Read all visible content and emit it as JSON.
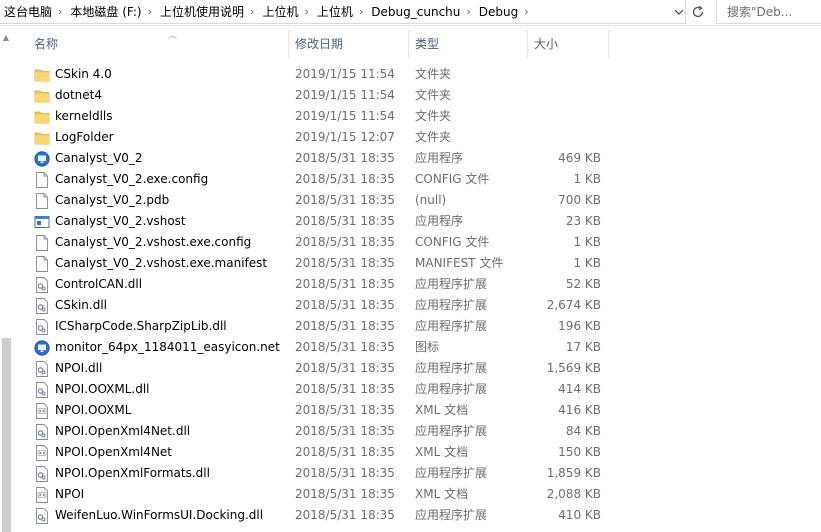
{
  "breadcrumb": {
    "items": [
      "这台电脑",
      "本地磁盘 (F:)",
      "上位机使用说明",
      "上位机",
      "上位机",
      "Debug_cunchu",
      "Debug"
    ]
  },
  "search": {
    "placeholder": "搜索\"Deb..."
  },
  "columns": {
    "name": "名称",
    "date": "修改日期",
    "type": "类型",
    "size": "大小"
  },
  "colors": {
    "folder": "#f0c85a",
    "header_text": "#4c607a",
    "meta_text": "#6d6d6d"
  },
  "files": [
    {
      "name": "CSkin 4.0",
      "date": "2019/1/15 11:54",
      "type": "文件夹",
      "size": "",
      "icon": "folder-icon"
    },
    {
      "name": "dotnet4",
      "date": "2019/1/15 11:54",
      "type": "文件夹",
      "size": "",
      "icon": "folder-icon"
    },
    {
      "name": "kerneldlls",
      "date": "2019/1/15 11:54",
      "type": "文件夹",
      "size": "",
      "icon": "folder-icon"
    },
    {
      "name": "LogFolder",
      "date": "2019/1/15 12:07",
      "type": "文件夹",
      "size": "",
      "icon": "folder-icon"
    },
    {
      "name": "Canalyst_V0_2",
      "date": "2018/5/31 18:35",
      "type": "应用程序",
      "size": "469 KB",
      "icon": "monitor-app-icon"
    },
    {
      "name": "Canalyst_V0_2.exe.config",
      "date": "2018/5/31 18:35",
      "type": "CONFIG 文件",
      "size": "1 KB",
      "icon": "file-icon"
    },
    {
      "name": "Canalyst_V0_2.pdb",
      "date": "2018/5/31 18:35",
      "type": "(null)",
      "size": "700 KB",
      "icon": "file-icon"
    },
    {
      "name": "Canalyst_V0_2.vshost",
      "date": "2018/5/31 18:35",
      "type": "应用程序",
      "size": "23 KB",
      "icon": "window-app-icon"
    },
    {
      "name": "Canalyst_V0_2.vshost.exe.config",
      "date": "2018/5/31 18:35",
      "type": "CONFIG 文件",
      "size": "1 KB",
      "icon": "file-icon"
    },
    {
      "name": "Canalyst_V0_2.vshost.exe.manifest",
      "date": "2018/5/31 18:35",
      "type": "MANIFEST 文件",
      "size": "1 KB",
      "icon": "file-icon"
    },
    {
      "name": "ControlCAN.dll",
      "date": "2018/5/31 18:35",
      "type": "应用程序扩展",
      "size": "52 KB",
      "icon": "dll-icon"
    },
    {
      "name": "CSkin.dll",
      "date": "2018/5/31 18:35",
      "type": "应用程序扩展",
      "size": "2,674 KB",
      "icon": "dll-icon"
    },
    {
      "name": "ICSharpCode.SharpZipLib.dll",
      "date": "2018/5/31 18:35",
      "type": "应用程序扩展",
      "size": "196 KB",
      "icon": "dll-icon"
    },
    {
      "name": "monitor_64px_1184011_easyicon.net",
      "date": "2018/5/31 18:35",
      "type": "图标",
      "size": "17 KB",
      "icon": "monitor-app-icon"
    },
    {
      "name": "NPOI.dll",
      "date": "2018/5/31 18:35",
      "type": "应用程序扩展",
      "size": "1,569 KB",
      "icon": "dll-icon"
    },
    {
      "name": "NPOI.OOXML.dll",
      "date": "2018/5/31 18:35",
      "type": "应用程序扩展",
      "size": "414 KB",
      "icon": "dll-icon"
    },
    {
      "name": "NPOI.OOXML",
      "date": "2018/5/31 18:35",
      "type": "XML 文档",
      "size": "416 KB",
      "icon": "xml-icon"
    },
    {
      "name": "NPOI.OpenXml4Net.dll",
      "date": "2018/5/31 18:35",
      "type": "应用程序扩展",
      "size": "84 KB",
      "icon": "dll-icon"
    },
    {
      "name": "NPOI.OpenXml4Net",
      "date": "2018/5/31 18:35",
      "type": "XML 文档",
      "size": "150 KB",
      "icon": "xml-icon"
    },
    {
      "name": "NPOI.OpenXmlFormats.dll",
      "date": "2018/5/31 18:35",
      "type": "应用程序扩展",
      "size": "1,859 KB",
      "icon": "dll-icon"
    },
    {
      "name": "NPOI",
      "date": "2018/5/31 18:35",
      "type": "XML 文档",
      "size": "2,088 KB",
      "icon": "xml-icon"
    },
    {
      "name": "WeifenLuo.WinFormsUI.Docking.dll",
      "date": "2018/5/31 18:35",
      "type": "应用程序扩展",
      "size": "410 KB",
      "icon": "dll-icon"
    }
  ]
}
